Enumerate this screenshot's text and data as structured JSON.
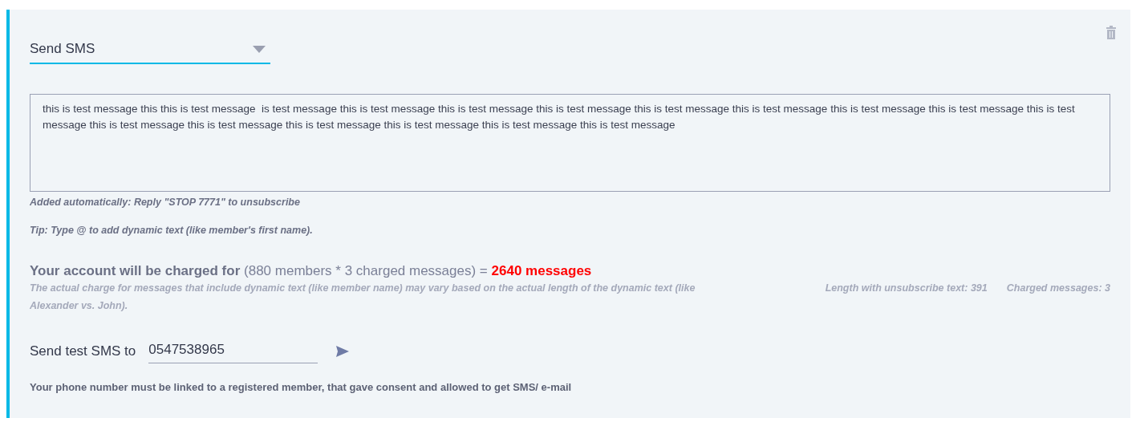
{
  "action_select": {
    "value": "Send SMS"
  },
  "message": {
    "value": "this is test message this this is test message  is test message this is test message this is test message this is test message this is test message this is test message this is test message this is test message this is test message this is test message this is test message this is test message this is test message this is test message this is test message"
  },
  "unsubscribe_note": "Added automatically: Reply \"STOP 7771\" to unsubscribe",
  "tip": "Tip: Type @ to add dynamic text (like member's first name).",
  "charge": {
    "label": "Your account will be charged for",
    "formula": "(880 members * 3 charged messages) =",
    "total": "2640 messages"
  },
  "charge_note": "The actual charge for messages that include dynamic text (like member name) may vary based on the actual length of the dynamic text (like Alexander vs. John).",
  "length_info": "Length with unsubscribe text: 391",
  "charged_info": "Charged messages: 3",
  "test_sms": {
    "label": "Send test SMS to",
    "value": "0547538965"
  },
  "phone_note": "Your phone number must be linked to a registered member, that gave consent and allowed to get SMS/ e-mail"
}
